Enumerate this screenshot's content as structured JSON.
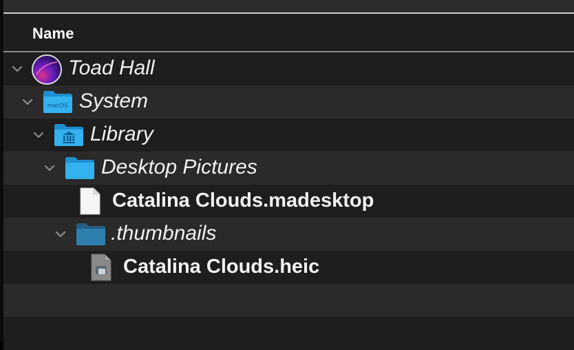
{
  "window": {
    "column_header": "Name"
  },
  "rows": [
    {
      "label": "Toad Hall",
      "kind": "disk",
      "icon": "macos-disk-icon",
      "expanded": true
    },
    {
      "label": "System",
      "kind": "folder",
      "icon": "macos-folder-icon",
      "badge": "macOS",
      "expanded": true
    },
    {
      "label": "Library",
      "kind": "folder",
      "icon": "library-folder-icon",
      "expanded": true
    },
    {
      "label": "Desktop Pictures",
      "kind": "folder",
      "icon": "folder-icon",
      "expanded": true
    },
    {
      "label": "Catalina Clouds.madesktop",
      "kind": "file",
      "icon": "document-icon"
    },
    {
      "label": ".thumbnails",
      "kind": "folder",
      "icon": "folder-icon",
      "expanded": true
    },
    {
      "label": "Catalina Clouds.heic",
      "kind": "file",
      "icon": "image-file-icon"
    }
  ],
  "colors": {
    "accent_folder": "#29a8ea",
    "hidden_folder": "#2f7fae",
    "row_alt": "#2a2a2a",
    "row_base": "#1e1e1e"
  }
}
